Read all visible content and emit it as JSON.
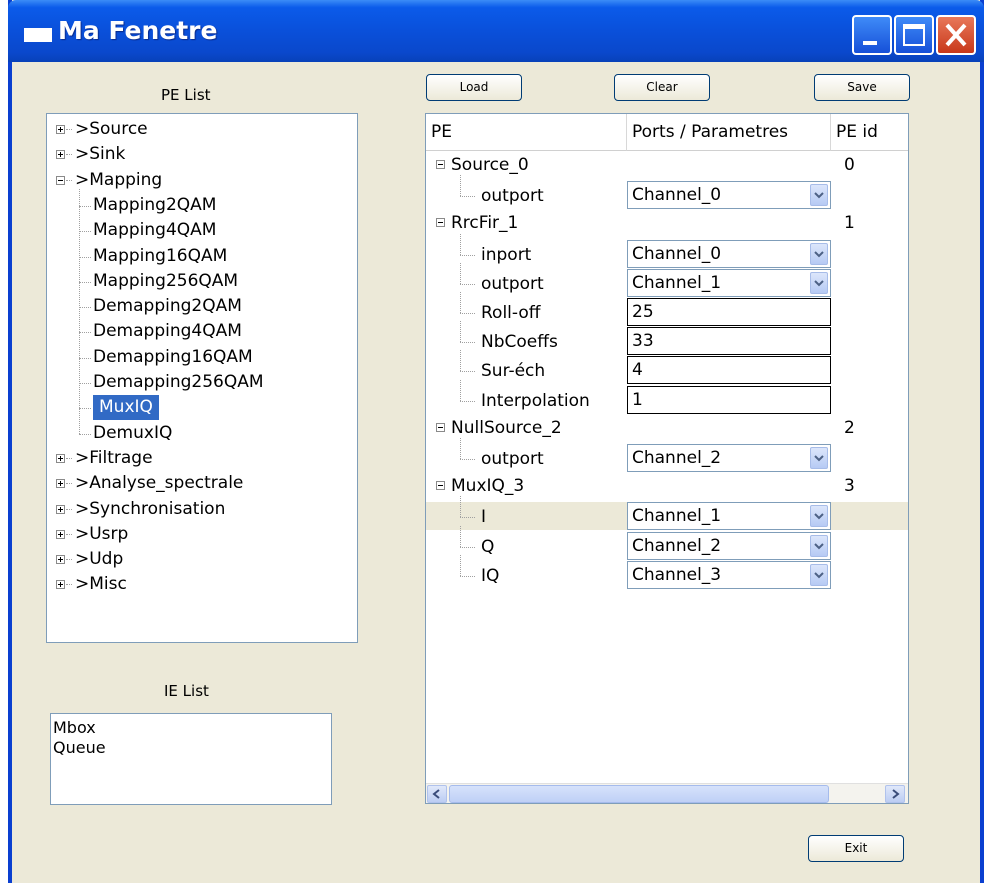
{
  "window": {
    "title": "Ma Fenetre"
  },
  "pe_list": {
    "label": "PE  List",
    "items": [
      {
        "label": ">Source",
        "expander": "plus"
      },
      {
        "label": ">Sink",
        "expander": "plus"
      },
      {
        "label": ">Mapping",
        "expander": "minus"
      },
      {
        "label": "Mapping2QAM"
      },
      {
        "label": "Mapping4QAM"
      },
      {
        "label": "Mapping16QAM"
      },
      {
        "label": "Mapping256QAM"
      },
      {
        "label": "Demapping2QAM"
      },
      {
        "label": "Demapping4QAM"
      },
      {
        "label": "Demapping16QAM"
      },
      {
        "label": "Demapping256QAM"
      },
      {
        "label": "MuxIQ",
        "selected": true
      },
      {
        "label": "DemuxIQ"
      },
      {
        "label": ">Filtrage",
        "expander": "plus"
      },
      {
        "label": ">Analyse_spectrale",
        "expander": "plus"
      },
      {
        "label": ">Synchronisation",
        "expander": "plus"
      },
      {
        "label": ">Usrp",
        "expander": "plus"
      },
      {
        "label": ">Udp",
        "expander": "plus"
      },
      {
        "label": ">Misc",
        "expander": "plus"
      }
    ]
  },
  "ie_list": {
    "label": "IE  List",
    "items": [
      "Mbox",
      "Queue"
    ]
  },
  "toolbar": {
    "load": "Load",
    "clear": "Clear",
    "save": "Save"
  },
  "exit_label": "Exit",
  "table": {
    "headers": {
      "pe": "PE",
      "ports": "Ports / Parametres",
      "id": "PE id"
    },
    "rows": [
      {
        "kind": "pe",
        "name": "Source_0",
        "id": "0"
      },
      {
        "kind": "combo",
        "name": "outport",
        "value": "Channel_0"
      },
      {
        "kind": "pe",
        "name": "RrcFir_1",
        "id": "1"
      },
      {
        "kind": "combo",
        "name": "inport",
        "value": "Channel_0"
      },
      {
        "kind": "combo",
        "name": "outport",
        "value": "Channel_1"
      },
      {
        "kind": "field",
        "name": "Roll-off",
        "value": "25"
      },
      {
        "kind": "field",
        "name": "NbCoeffs",
        "value": "33"
      },
      {
        "kind": "field",
        "name": "Sur-éch",
        "value": "4"
      },
      {
        "kind": "field",
        "name": "Interpolation",
        "value": "1"
      },
      {
        "kind": "pe",
        "name": "NullSource_2",
        "id": "2"
      },
      {
        "kind": "combo",
        "name": "outport",
        "value": "Channel_2"
      },
      {
        "kind": "pe",
        "name": "MuxIQ_3",
        "id": "3"
      },
      {
        "kind": "combo",
        "name": "I",
        "value": "Channel_1",
        "highlight": true
      },
      {
        "kind": "combo",
        "name": "Q",
        "value": "Channel_2"
      },
      {
        "kind": "combo",
        "name": "IQ",
        "value": "Channel_3"
      }
    ]
  }
}
